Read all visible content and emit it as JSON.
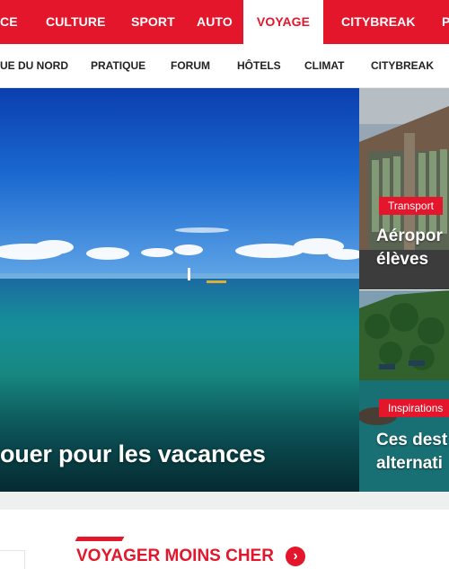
{
  "top_nav": {
    "items": [
      {
        "label": "CE"
      },
      {
        "label": "CULTURE"
      },
      {
        "label": "SPORT"
      },
      {
        "label": "AUTO"
      },
      {
        "label": "VOYAGE",
        "active": true
      },
      {
        "label": "CITYBREAK"
      },
      {
        "label": "P"
      }
    ]
  },
  "sub_nav": {
    "items": [
      {
        "label": "UE DU NORD"
      },
      {
        "label": "PRATIQUE"
      },
      {
        "label": "FORUM"
      },
      {
        "label": "HÔTELS"
      },
      {
        "label": "CLIMAT"
      },
      {
        "label": "CITYBREAK"
      }
    ]
  },
  "hero": {
    "title": "ouer pour les vacances"
  },
  "cards": [
    {
      "tag": "Transport",
      "title_line1": "Aéropor",
      "title_line2": "élèves"
    },
    {
      "tag": "Inspirations",
      "title_line1": "Ces dest",
      "title_line2": "alternati"
    }
  ],
  "section": {
    "title": "VOYAGER MOINS CHER",
    "arrow_icon": "chevron-right-icon"
  },
  "colors": {
    "brand_red": "#e3162c",
    "text_dark": "#222222",
    "band_gray": "#eef0f0"
  }
}
